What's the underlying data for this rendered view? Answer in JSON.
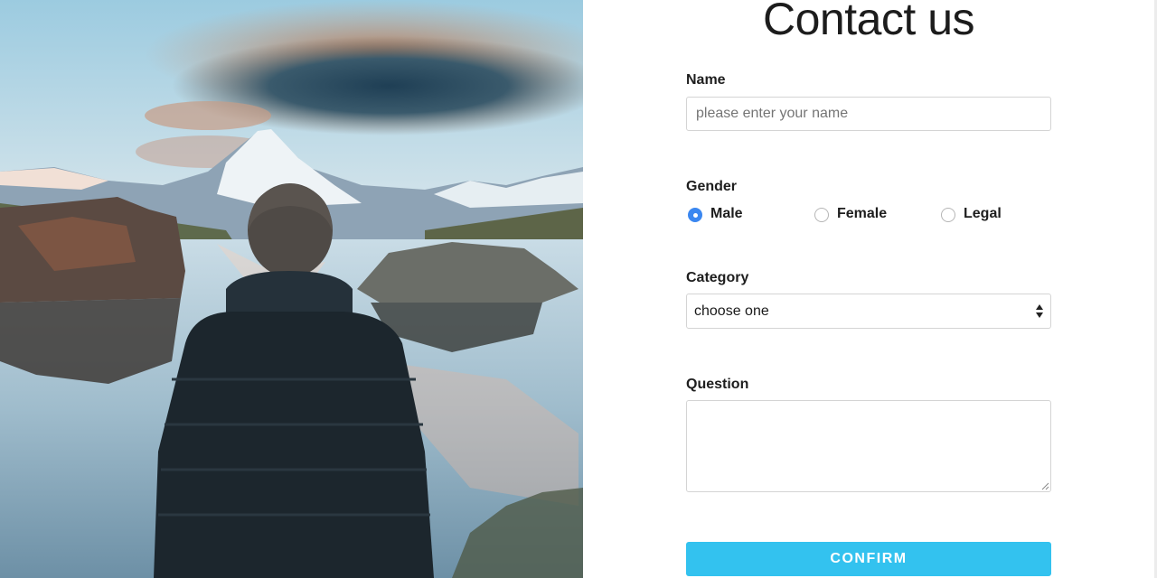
{
  "page": {
    "title": "Contact us"
  },
  "hero_image": {
    "description": "man in dark puffer jacket facing mountain lake",
    "icon": "landscape-photo"
  },
  "form": {
    "name": {
      "label": "Name",
      "value": "",
      "placeholder": "please enter your name"
    },
    "gender": {
      "label": "Gender",
      "options": [
        {
          "label": "Male",
          "checked": true
        },
        {
          "label": "Female",
          "checked": false
        },
        {
          "label": "Legal",
          "checked": false
        }
      ]
    },
    "category": {
      "label": "Category",
      "selected": "choose one"
    },
    "question": {
      "label": "Question",
      "value": ""
    },
    "confirm_label": "CONFIRM"
  },
  "colors": {
    "accent": "#33c2ef",
    "radio_checked": "#3b87f0"
  }
}
